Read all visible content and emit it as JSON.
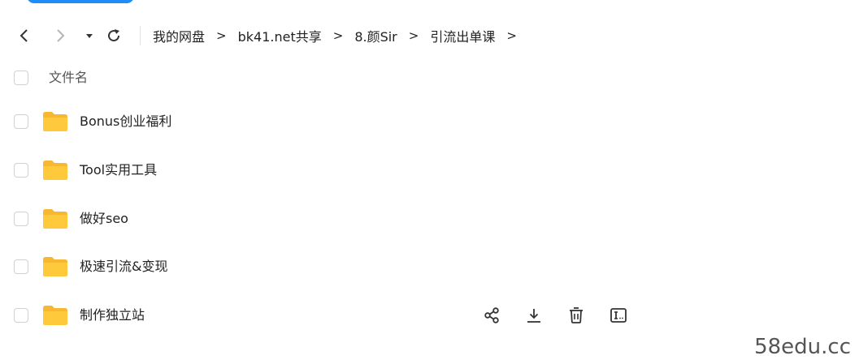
{
  "breadcrumb": {
    "items": [
      "我的网盘",
      "bk41.net共享",
      "8.颜Sir",
      "引流出单课"
    ],
    "separator": ">"
  },
  "list": {
    "column_header": "文件名",
    "rows": [
      {
        "name": "Bonus创业福利",
        "type": "folder"
      },
      {
        "name": "Tool实用工具",
        "type": "folder"
      },
      {
        "name": "做好seo",
        "type": "folder"
      },
      {
        "name": "极速引流&变现",
        "type": "folder"
      },
      {
        "name": "制作独立站",
        "type": "folder"
      }
    ]
  },
  "row_actions": [
    "share-icon",
    "download-icon",
    "delete-icon",
    "rename-icon"
  ],
  "icons": {
    "back": "chevron-left-icon",
    "forward": "chevron-right-icon",
    "history": "caret-down-icon",
    "refresh": "refresh-icon",
    "folder": "folder-icon"
  },
  "watermark": "58edu.cc",
  "colors": {
    "accent": "#1e8df5",
    "folder": "#ffc93c",
    "folder_tab": "#f7b731"
  }
}
